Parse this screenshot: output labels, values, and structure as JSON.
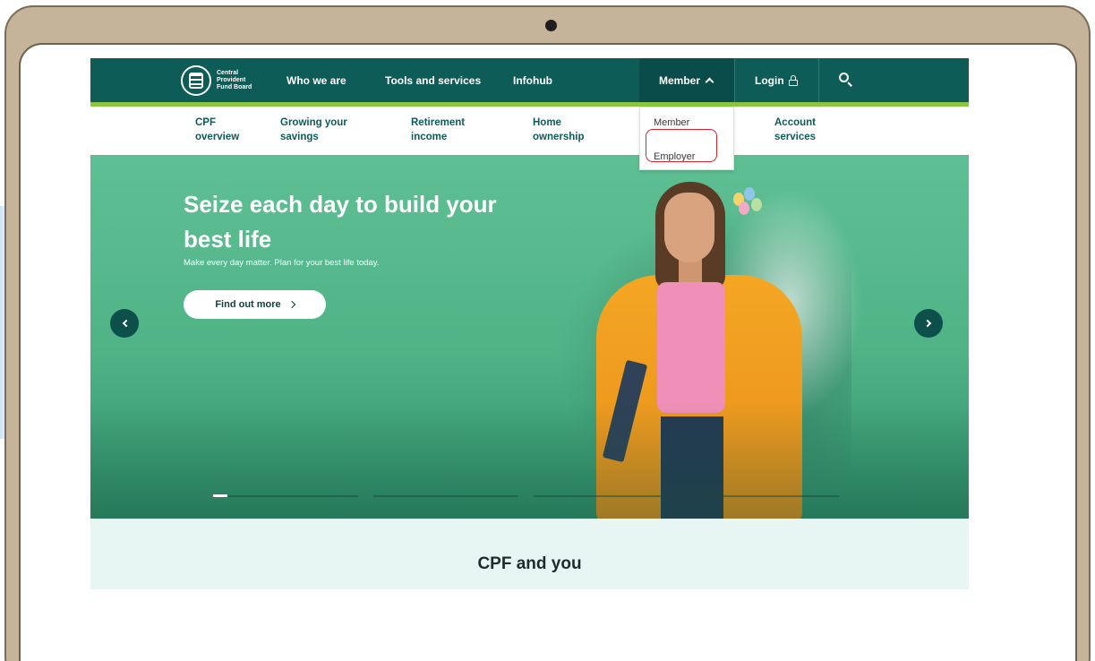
{
  "brand": {
    "logo_lines": [
      "Central",
      "Provident",
      "Fund Board"
    ]
  },
  "topnav": {
    "items": [
      "Who we are",
      "Tools and services",
      "Infohub"
    ],
    "member_label": "Member",
    "login_label": "Login"
  },
  "member_menu": {
    "items": [
      "Member",
      "Employer"
    ],
    "highlighted": "Employer"
  },
  "subnav": {
    "items": [
      [
        "CPF",
        "overview"
      ],
      [
        "Growing your",
        "savings"
      ],
      [
        "Retirement",
        "income"
      ],
      [
        "Home",
        "ownership"
      ],
      [
        "Account",
        "services"
      ]
    ]
  },
  "hero": {
    "title": "Seize each day to build your best life",
    "subtitle": "Make every day matter. Plan for your best life today.",
    "cta_label": "Find out more",
    "slide_progress": [
      0.1,
      0,
      0,
      0
    ]
  },
  "section": {
    "title": "CPF and you"
  },
  "icons": {
    "lock": "lock-icon",
    "search": "search-icon",
    "chevron_up": "chevron-up-icon",
    "prev": "chevron-left-icon",
    "next": "chevron-right-icon"
  },
  "colors": {
    "nav_bg": "#0d5c58",
    "accent_strip": "#8cc63f",
    "hero_bg": "#5fbf94",
    "section_bg": "#e8f6f3",
    "highlight": "#d9232d"
  }
}
